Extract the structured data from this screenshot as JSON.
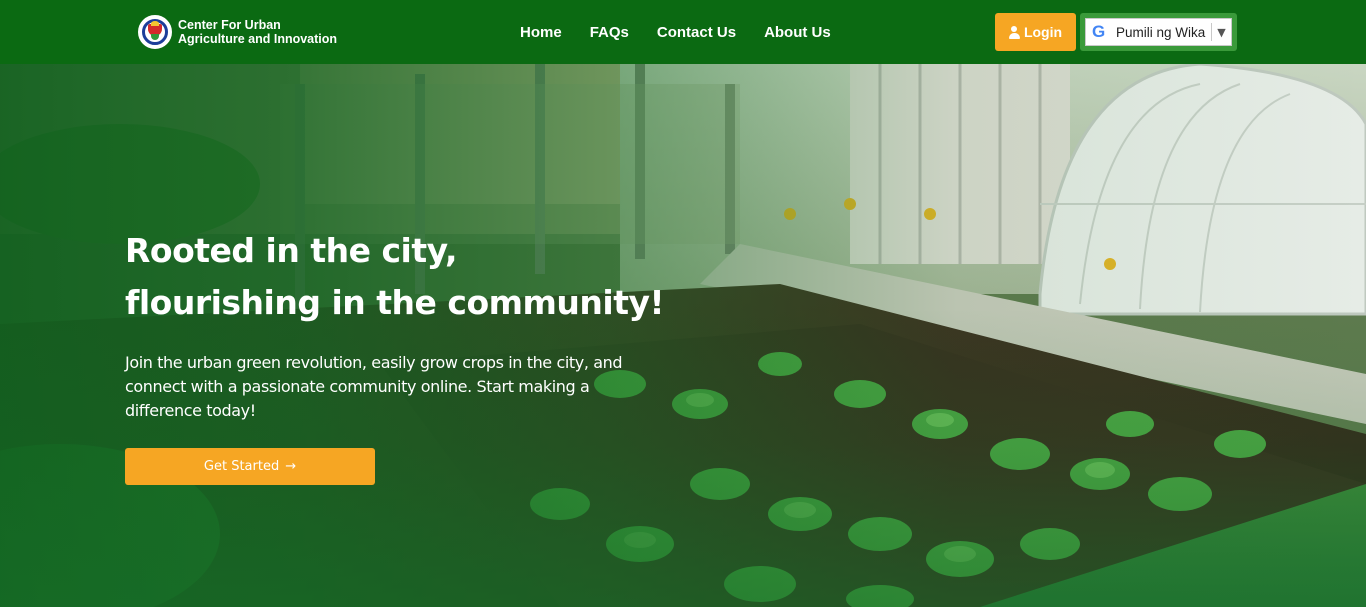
{
  "navbar": {
    "brand_line1": "Center For Urban",
    "brand_line2": "Agriculture and Innovation",
    "links": [
      "Home",
      "FAQs",
      "Contact Us",
      "About Us"
    ],
    "login_label": "Login",
    "language_selector_label": "Pumili ng Wika",
    "google_icon_letter": "G"
  },
  "hero": {
    "title_line1": "Rooted in the city,",
    "title_line2": "flourishing in the community!",
    "subtitle": "Join the urban green revolution, easily grow crops in the city, and connect with a passionate community online. Start making a difference today!",
    "cta_label": "Get Started",
    "cta_arrow": "→"
  },
  "colors": {
    "navbar_bg": "#0b6a12",
    "accent_orange": "#f6a623",
    "translate_bg": "#3a9a3a"
  }
}
